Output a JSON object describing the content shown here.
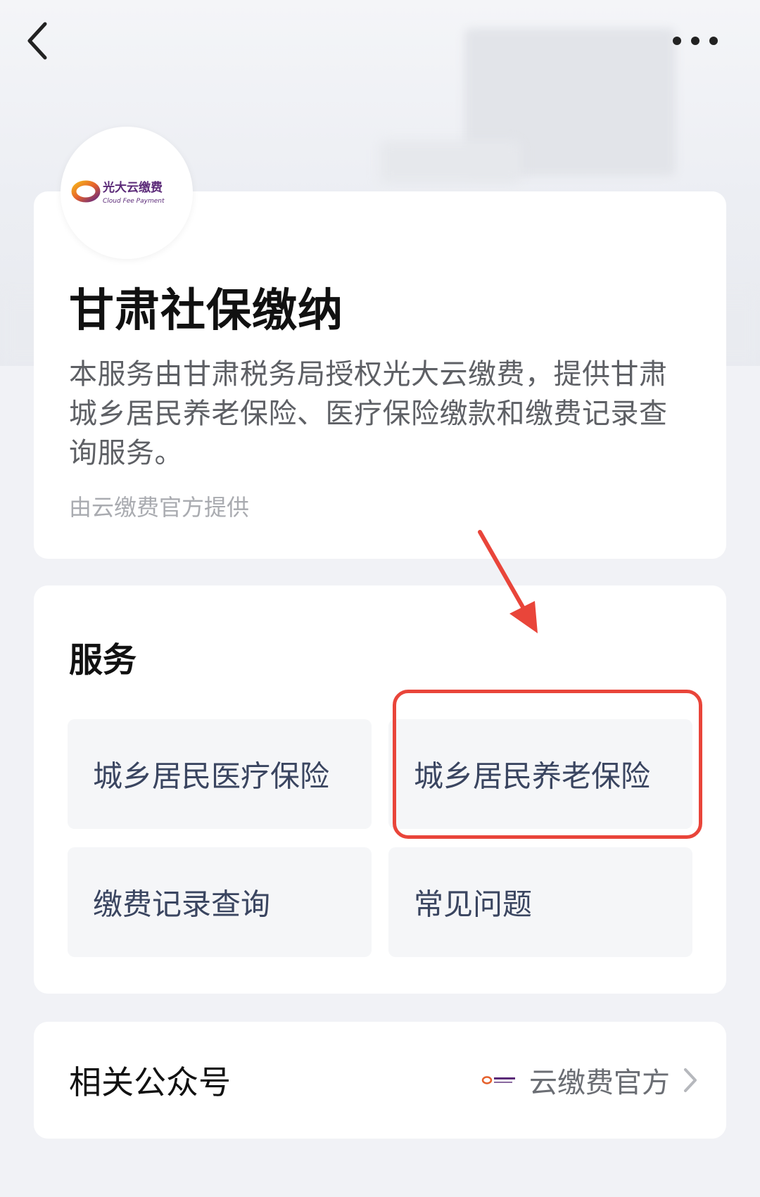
{
  "header": {
    "back_icon": "chevron-left-icon",
    "more_icon": "more-dots-icon"
  },
  "intro": {
    "logo": {
      "brand_cn": "光大云缴费",
      "brand_en": "Cloud Fee Payment"
    },
    "title": "甘肃社保缴纳",
    "description": "本服务由甘肃税务局授权光大云缴费，提供甘肃城乡居民养老保险、医疗保险缴款和缴费记录查询服务。",
    "provider": "由云缴费官方提供"
  },
  "services": {
    "title": "服务",
    "items": [
      {
        "label": "城乡居民医疗保险"
      },
      {
        "label": "城乡居民养老保险",
        "highlighted": true
      },
      {
        "label": "缴费记录查询"
      },
      {
        "label": "常见问题"
      }
    ]
  },
  "related": {
    "label": "相关公众号",
    "account_name": "云缴费官方",
    "chevron_icon": "chevron-right-icon"
  },
  "annotation": {
    "color": "#e9453a"
  }
}
